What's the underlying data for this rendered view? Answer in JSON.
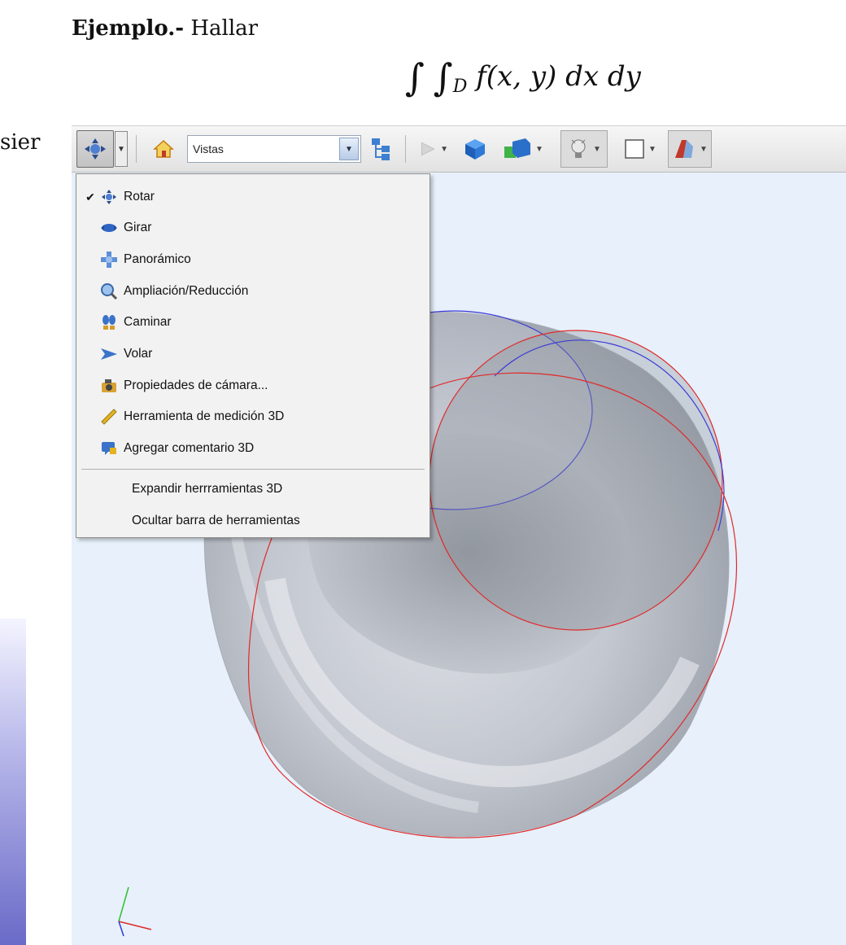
{
  "document": {
    "example_label": "Ejemplo.-",
    "example_text": "Hallar",
    "formula": {
      "integral1": "∫",
      "integral2": "∫",
      "domain": "D",
      "body": "f(x, y) dx dy"
    },
    "partial_text": "sier"
  },
  "toolbar": {
    "views_select": "Vistas",
    "buttons": [
      "rotate-tool",
      "home",
      "views",
      "model-tree",
      "play",
      "render-mode",
      "parts",
      "lighting",
      "background",
      "cross-section"
    ]
  },
  "menu": {
    "items": [
      {
        "label": "Rotar",
        "checked": true,
        "icon": "rotate-icon"
      },
      {
        "label": "Girar",
        "checked": false,
        "icon": "spin-icon"
      },
      {
        "label": "Panorámico",
        "checked": false,
        "icon": "pan-icon"
      },
      {
        "label": "Ampliación/Reducción",
        "checked": false,
        "icon": "zoom-icon"
      },
      {
        "label": "Caminar",
        "checked": false,
        "icon": "walk-icon"
      },
      {
        "label": "Volar",
        "checked": false,
        "icon": "fly-icon"
      },
      {
        "label": "Propiedades de cámara...",
        "checked": false,
        "icon": "camera-icon"
      },
      {
        "label": "Herramienta de medición 3D",
        "checked": false,
        "icon": "ruler-icon"
      },
      {
        "label": "Agregar comentario 3D",
        "checked": false,
        "icon": "comment-icon"
      }
    ],
    "extra": [
      {
        "label": "Expandir herrramientas 3D"
      },
      {
        "label": "Ocultar barra de herramientas"
      }
    ]
  },
  "colors": {
    "viewport_bg": "#e7f0fb",
    "curve_red": "#e02a2a",
    "curve_blue": "#3b3bd6",
    "surface": "#b9bdc6"
  }
}
